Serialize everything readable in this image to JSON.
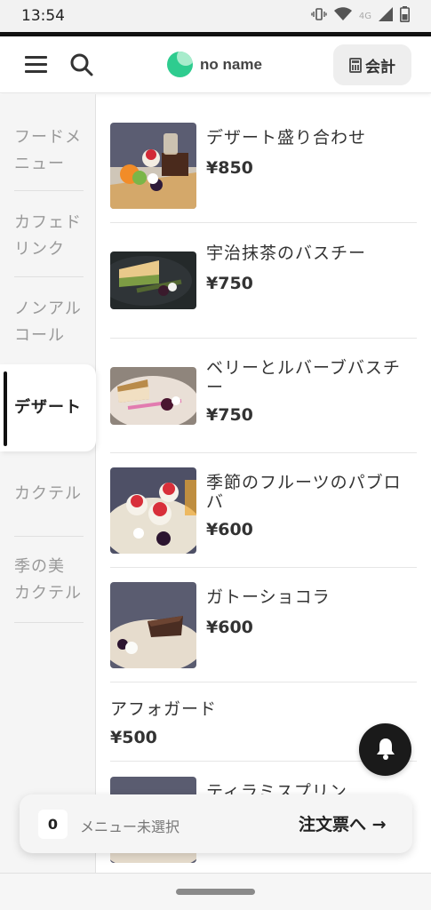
{
  "status_bar": {
    "time": "13:54",
    "network": "4G"
  },
  "header": {
    "logo_text": "no name",
    "checkout_label": "会計"
  },
  "categories": [
    {
      "line1": "フードメ",
      "line2": "ニュー"
    },
    {
      "line1": "カフェド",
      "line2": "リンク"
    },
    {
      "line1": "ノンアル",
      "line2": "コール"
    },
    {
      "line1": "デザート",
      "line2": ""
    },
    {
      "line1": "カクテル",
      "line2": ""
    },
    {
      "line1": "季の美",
      "line2": "カクテル"
    }
  ],
  "active_category": "デザート",
  "items": [
    {
      "name": "デザート盛り合わせ",
      "price": "¥850"
    },
    {
      "name": "宇治抹茶のバスチー",
      "price": "¥750"
    },
    {
      "name": "ベリーとルバーブバスチー",
      "price": "¥750"
    },
    {
      "name": "季節のフルーツのパブロバ",
      "price": "¥600"
    },
    {
      "name": "ガトーショコラ",
      "price": "¥600"
    },
    {
      "name": "アフォガード",
      "price": "¥500"
    },
    {
      "name": "ティラミスプリン",
      "price": ""
    }
  ],
  "cart": {
    "count": "0",
    "label": "メニュー未選択",
    "order_label": "注文票へ →"
  },
  "colors": {
    "accent": "#2ecc8f",
    "active_bar": "#111111"
  }
}
